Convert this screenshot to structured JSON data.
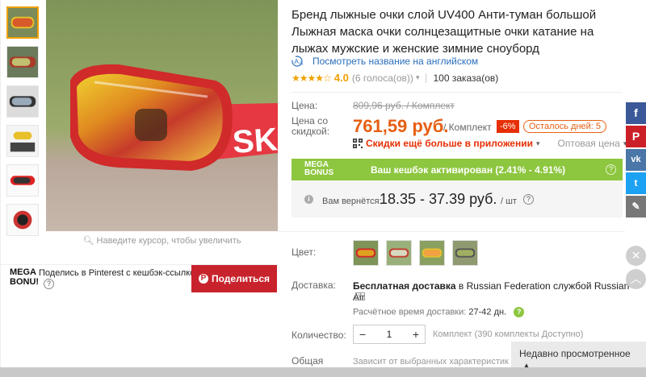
{
  "product": {
    "title": "Бренд лыжные очки слой UV400 Анти-туман большой Лыжная маска очки солнцезащитные очки катание на лыжах мужские и женские зимние сноуборд",
    "translate_link": "Посмотреть название на английском",
    "translate_icon": "translate-icon",
    "rating_stars": "★★★★☆",
    "rating_value": "4.0",
    "votes": "(6 голоса(ов))",
    "orders": "100 заказа(ов)"
  },
  "gallery": {
    "zoom_hint": "Наведите курсор, чтобы увеличить",
    "thumbnail_count": 6
  },
  "pinterest": {
    "mega_label_line1": "MEGA",
    "mega_label_line2": "BONU!",
    "text": "Поделись в Pinterest с кешбэк-ссылкой",
    "help": "?",
    "button_label": "Поделиться",
    "button_icon": "P"
  },
  "price": {
    "price_label": "Цена:",
    "old_price": "809,96 руб. / Комплект",
    "discount_price_label_1": "Цена со",
    "discount_price_label_2": "скидкой:",
    "current_price": "761,59 руб.",
    "per_unit": "/ Комплект",
    "discount_badge": "-6%",
    "days_left": "Осталось дней: 5",
    "app_discount": "Скидки ещё больше в приложении",
    "wholesale": "Оптовая цена",
    "caret": "▾"
  },
  "cashback": {
    "mega_line1": "MEGA",
    "mega_line2": "BONUS",
    "text": "Ваш кешбэк активирован (2.41% - 4.91%)",
    "help": "?",
    "refund_label": "Вам вернётся:",
    "refund_value": "18.35 - 37.39 руб.",
    "refund_per": "/ шт",
    "info": "i"
  },
  "options": {
    "color_label": "Цвет:",
    "shipping_label": "Доставка:",
    "shipping_prefix": "Бесплатная доставка ",
    "shipping_to": "в Russian Federation службой Russian Air",
    "shipping_dropdown": "v",
    "estimate_label": "Расчётное время доставки:",
    "estimate_value": "27-42 дн.",
    "quantity_label": "Количество:",
    "quantity_value": "1",
    "minus": "−",
    "plus": "+",
    "quantity_note": "Комплект (390 комплекты Доступно)",
    "total_label": "Общая",
    "total_note": "Зависит от выбранных характеристик"
  },
  "recently_viewed": {
    "label": "Недавно просмотренное",
    "caret": "▲"
  },
  "social": {
    "facebook": "f",
    "pinterest": "P",
    "vk": "vk",
    "twitter": "t",
    "edit": "✎",
    "close": "✕",
    "up": "︿"
  },
  "colors": {
    "accent_orange": "#e65f12",
    "cashback_green": "#8dc63f",
    "pinterest_red": "#c8232c",
    "link_blue": "#2a6ebb"
  }
}
